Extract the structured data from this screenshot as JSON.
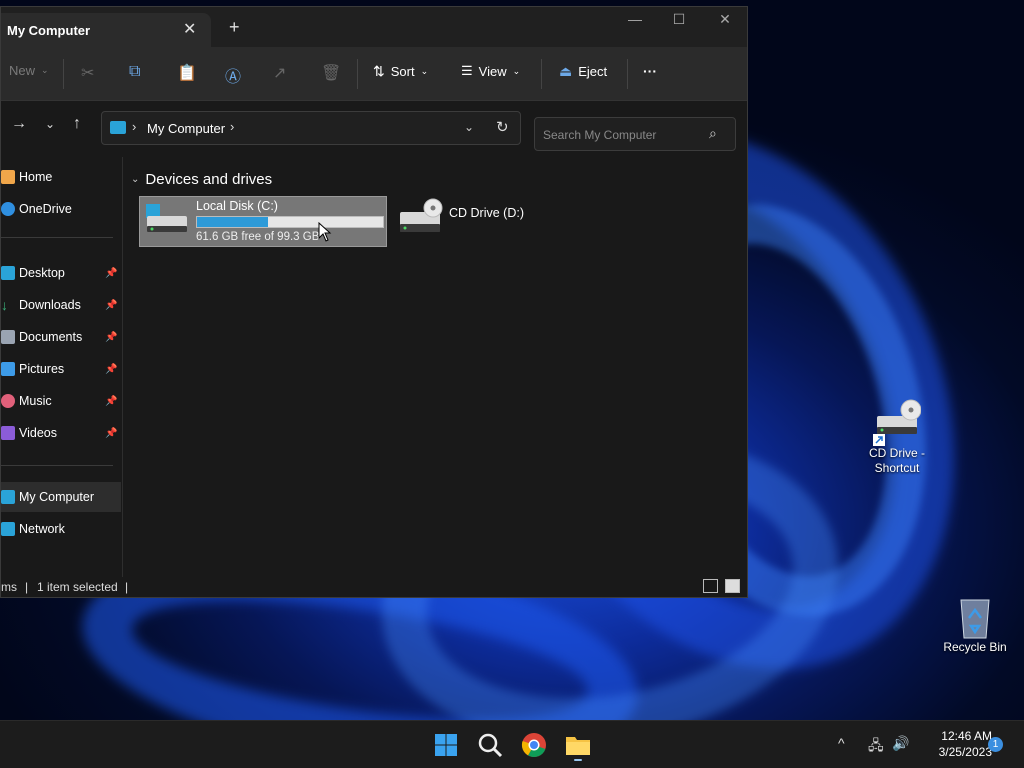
{
  "explorer": {
    "tab_title": "My Computer",
    "toolbar": {
      "new_label": "New",
      "sort_label": "Sort",
      "view_label": "View",
      "eject_label": "Eject",
      "more_label": "···"
    },
    "address": {
      "path_label": "My Computer",
      "search_placeholder": "Search My Computer"
    },
    "nav_items": [
      {
        "label": "Home",
        "icon": "home-icon",
        "color": "#f0a64a"
      },
      {
        "label": "OneDrive",
        "icon": "cloud-icon",
        "color": "#2f8fe0"
      },
      {
        "label": "Desktop",
        "icon": "desktop-icon",
        "color": "#2aa3d8"
      },
      {
        "label": "Downloads",
        "icon": "download-icon",
        "color": "#3ab07a"
      },
      {
        "label": "Documents",
        "icon": "document-icon",
        "color": "#9aa4b2"
      },
      {
        "label": "Pictures",
        "icon": "picture-icon",
        "color": "#3d9be8"
      },
      {
        "label": "Music",
        "icon": "music-icon",
        "color": "#e0607a"
      },
      {
        "label": "Videos",
        "icon": "video-icon",
        "color": "#8b5cd8"
      },
      {
        "label": "My Computer",
        "icon": "computer-icon",
        "color": "#2aa3d8"
      },
      {
        "label": "Network",
        "icon": "network-icon",
        "color": "#2aa3d8"
      }
    ],
    "group_title": "Devices and drives",
    "drives": [
      {
        "name": "Local Disk (C:)",
        "free_text": "61.6 GB free of 99.3 GB",
        "used_fraction": 0.38
      },
      {
        "name": "CD Drive (D:)"
      }
    ],
    "status": {
      "items_fragment": "ms",
      "selected_text": "1 item selected"
    }
  },
  "desktop": {
    "cd_shortcut_label_line1": "CD Drive -",
    "cd_shortcut_label_line2": "Shortcut",
    "recycle_bin_label": "Recycle Bin"
  },
  "taskbar": {
    "time": "12:46 AM",
    "date": "3/25/2023",
    "notification_count": "1"
  }
}
